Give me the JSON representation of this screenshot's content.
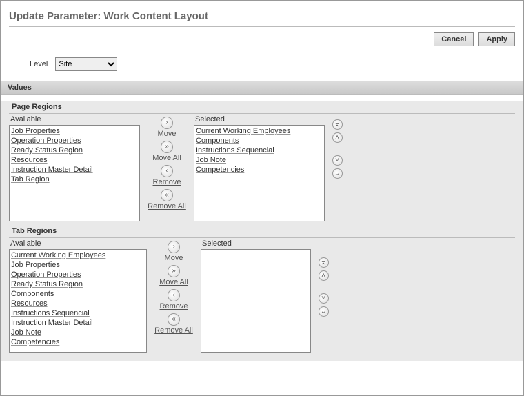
{
  "title": "Update Parameter: Work Content Layout",
  "buttons": {
    "cancel": "Cancel",
    "apply": "Apply"
  },
  "level": {
    "label": "Level",
    "selected": "Site",
    "options": [
      "Site"
    ]
  },
  "section_values": "Values",
  "labels": {
    "available": "Available",
    "selected": "Selected",
    "move": "Move",
    "move_all": "Move All",
    "remove": "Remove",
    "remove_all": "Remove All"
  },
  "page_regions": {
    "header": "Page Regions",
    "available": [
      "Job Properties",
      "Operation Properties",
      "Ready Status Region",
      "Resources",
      "Instruction Master Detail",
      "Tab Region"
    ],
    "selected": [
      "Current Working Employees",
      "Components",
      "Instructions Sequencial",
      "Job Note",
      "Competencies"
    ]
  },
  "tab_regions": {
    "header": "Tab Regions",
    "available": [
      "Current Working Employees",
      "Job Properties",
      "Operation Properties",
      "Ready Status Region",
      "Components",
      "Resources",
      "Instructions Sequencial",
      "Instruction Master Detail",
      "Job Note",
      "Competencies"
    ],
    "selected": []
  },
  "glyphs": {
    "right": "›",
    "right2": "»",
    "left": "‹",
    "left2": "«",
    "top": "⌅",
    "up": "˄",
    "down": "˅",
    "bottom": "⌄"
  }
}
